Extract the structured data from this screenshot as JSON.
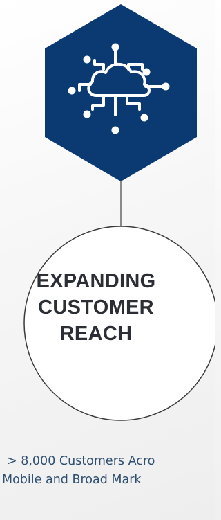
{
  "diagram": {
    "icon": "cloud-network-icon",
    "colors": {
      "hexagon_fill": "#0b3a73",
      "icon_stroke": "#ffffff",
      "connector": "#8a8a8a",
      "circle_border": "#3a3a3a",
      "circle_text": "#2b2f35",
      "caption_text": "#2f4f6f"
    },
    "circle_label_lines": [
      "EXPANDING",
      "CUSTOMER",
      "REACH"
    ],
    "caption_lines": [
      "> 8,000 Customers Acro",
      "Mobile and Broad Mark"
    ]
  }
}
